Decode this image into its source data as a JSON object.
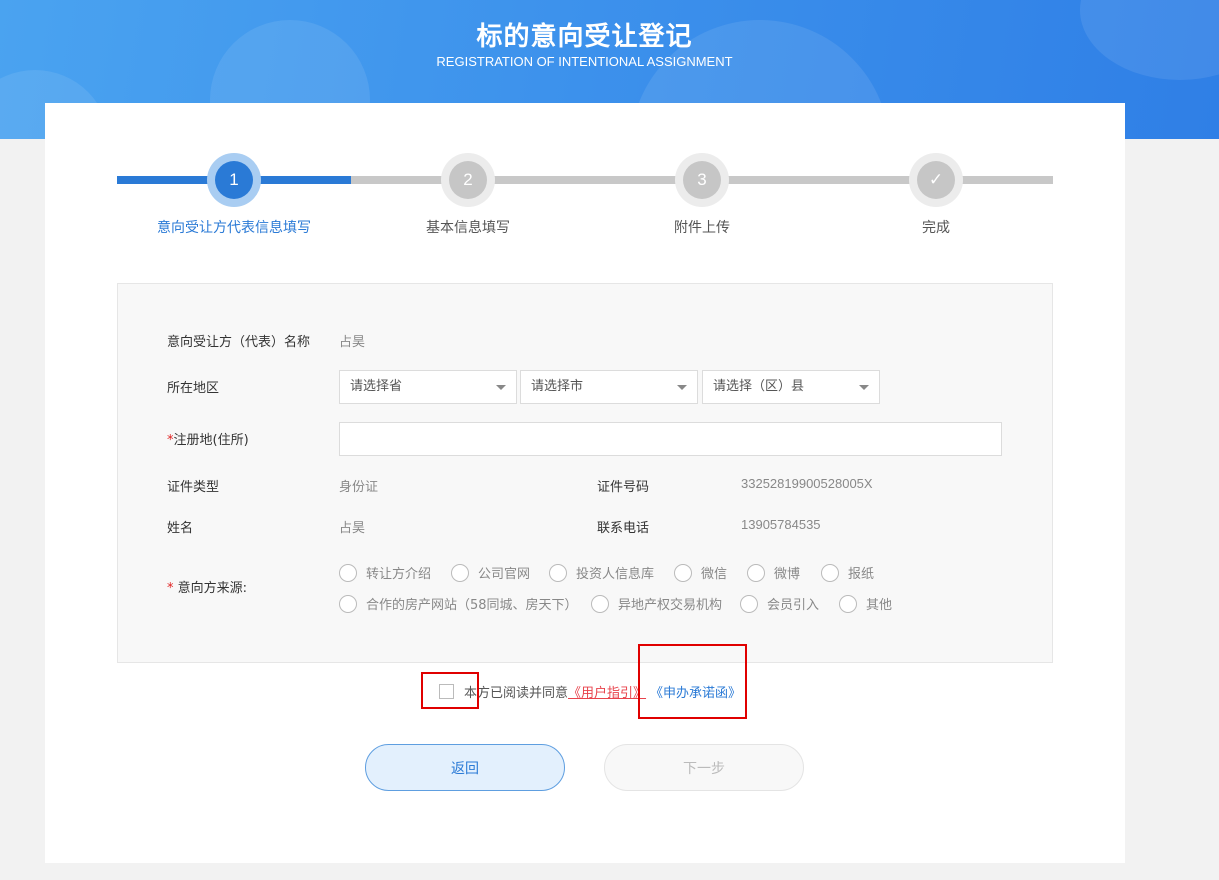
{
  "header": {
    "title": "标的意向受让登记",
    "subtitle": "REGISTRATION OF INTENTIONAL ASSIGNMENT"
  },
  "steps": [
    {
      "number": "1",
      "label": "意向受让方代表信息填写",
      "active": true
    },
    {
      "number": "2",
      "label": "基本信息填写",
      "active": false
    },
    {
      "number": "3",
      "label": "附件上传",
      "active": false
    },
    {
      "number": "✓",
      "label": "完成",
      "active": false
    }
  ],
  "form": {
    "name_label": "意向受让方（代表）名称",
    "name_value": "占昊",
    "region_label": "所在地区",
    "province_placeholder": "请选择省",
    "city_placeholder": "请选择市",
    "county_placeholder": "请选择（区）县",
    "address_required": "*",
    "address_label": "注册地(住所)",
    "address_value": "",
    "id_type_label": "证件类型",
    "id_type_value": "身份证",
    "id_number_label": "证件号码",
    "id_number_value": "33252819900528005X",
    "person_name_label": "姓名",
    "person_name_value": "占昊",
    "phone_label": "联系电话",
    "phone_value": "13905784535",
    "source_required": "*",
    "source_label": " 意向方来源:",
    "source_options_row1": [
      "转让方介绍",
      "公司官网",
      "投资人信息库",
      "微信",
      "微博",
      "报纸"
    ],
    "source_options_row2": [
      "合作的房产网站（58同城、房天下）",
      "异地产权交易机构",
      "会员引入",
      "其他"
    ]
  },
  "agreement": {
    "text": "本方已阅读并同意",
    "user_guide_link": "《用户指引》",
    "promise_link": "《申办承诺函》"
  },
  "buttons": {
    "back_label": "返回",
    "next_label": "下一步"
  },
  "colors": {
    "primary": "#2a7ad6",
    "required": "#e02020",
    "highlight_box": "#e00000",
    "link_guide": "#e8424b"
  }
}
